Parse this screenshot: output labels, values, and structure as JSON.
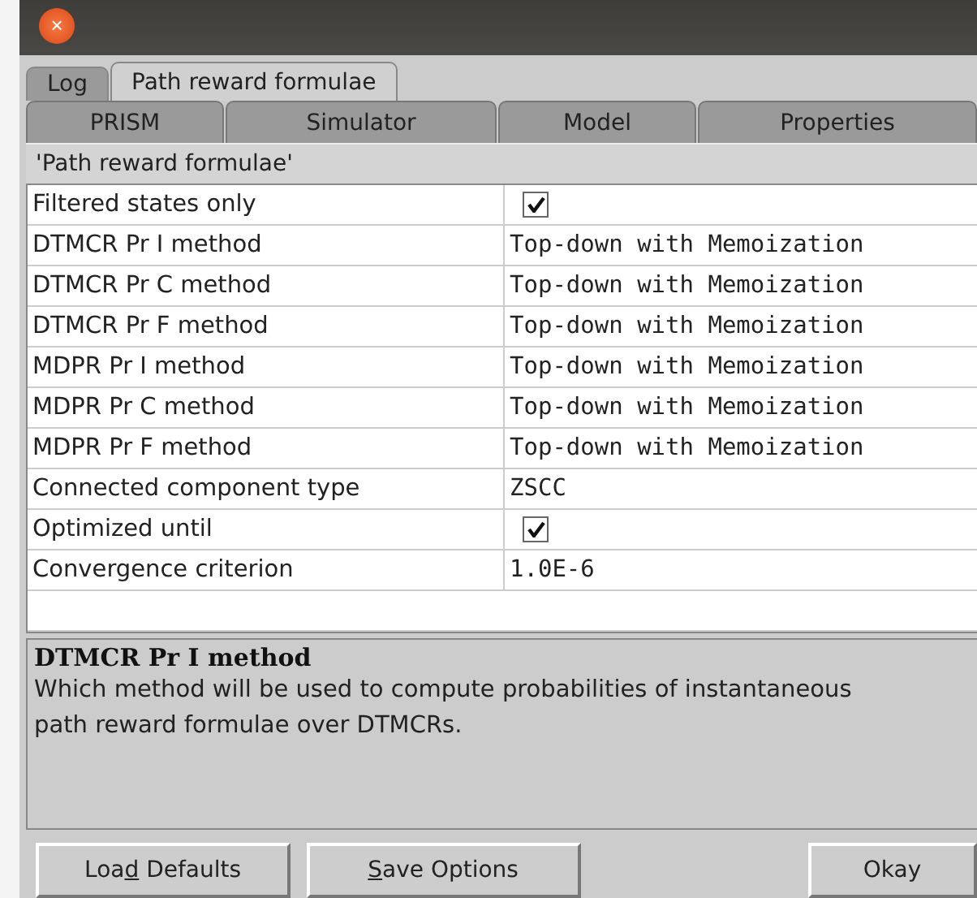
{
  "window": {
    "close_glyph": "×"
  },
  "tabs_top": [
    {
      "label": "Log",
      "selected": false
    },
    {
      "label": "Path reward formulae",
      "selected": true
    }
  ],
  "tabs_bottom": [
    {
      "label": "PRISM"
    },
    {
      "label": "Simulator"
    },
    {
      "label": "Model"
    },
    {
      "label": "Properties"
    }
  ],
  "section_title": "'Path reward formulae'",
  "properties": [
    {
      "name": "Filtered states only",
      "kind": "checkbox",
      "checked": true
    },
    {
      "name": "DTMCR Pr I method",
      "kind": "text",
      "value": "Top-down with Memoization"
    },
    {
      "name": "DTMCR Pr C method",
      "kind": "text",
      "value": "Top-down with Memoization"
    },
    {
      "name": "DTMCR Pr F method",
      "kind": "text",
      "value": "Top-down with Memoization"
    },
    {
      "name": "MDPR Pr I method",
      "kind": "text",
      "value": "Top-down with Memoization"
    },
    {
      "name": "MDPR Pr C method",
      "kind": "text",
      "value": "Top-down with Memoization"
    },
    {
      "name": "MDPR Pr F method",
      "kind": "text",
      "value": "Top-down with Memoization"
    },
    {
      "name": "Connected component type",
      "kind": "text",
      "value": "ZSCC"
    },
    {
      "name": "Optimized until",
      "kind": "checkbox",
      "checked": true
    },
    {
      "name": "Convergence criterion",
      "kind": "text",
      "value": "1.0E-6"
    }
  ],
  "description": {
    "title": "DTMCR Pr I method",
    "text": "Which method will be used to compute probabilities of instantaneous path reward formulae over DTMCRs."
  },
  "buttons": [
    {
      "before": "Loa",
      "key": "d",
      "after": " Defaults"
    },
    {
      "key": "S",
      "after": "ave Options"
    },
    {
      "before": "Okay"
    }
  ]
}
